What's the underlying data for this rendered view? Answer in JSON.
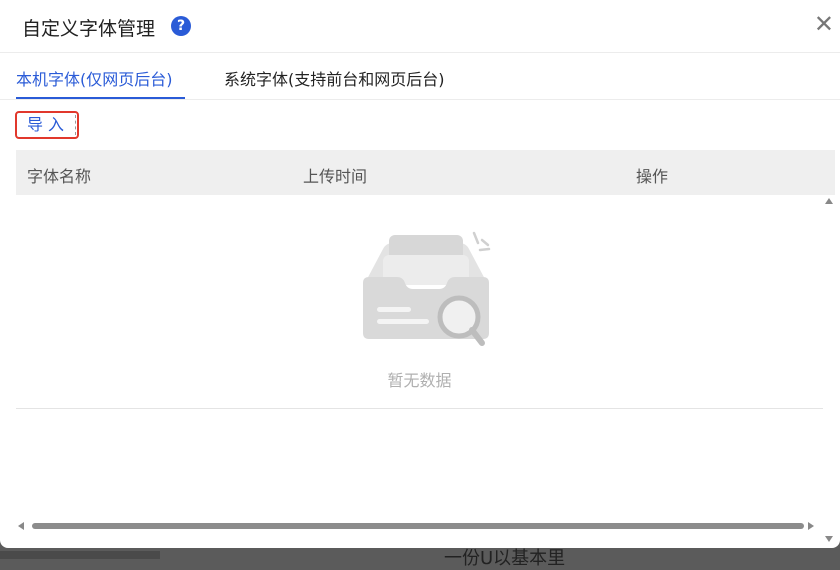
{
  "background_page": {
    "partial_text": "一份U以基本里"
  },
  "dialog": {
    "title": "自定义字体管理",
    "help_glyph": "?",
    "close_glyph": "✕",
    "tabs": [
      {
        "label": "本机字体(仅网页后台)",
        "active": true
      },
      {
        "label": "系统字体(支持前台和网页后台)",
        "active": false
      }
    ],
    "import_label": "导入",
    "table": {
      "columns": [
        "字体名称",
        "上传时间",
        "操作"
      ],
      "rows": []
    },
    "empty_text": "暂无数据"
  },
  "icons": {
    "help": "question-circle-icon",
    "close": "close-icon",
    "empty": "empty-inbox-search-icon"
  },
  "colors": {
    "accent": "#2a5bd7",
    "highlight_border": "#e1382c",
    "table_header_bg": "#efefef",
    "muted_text": "#b0b0b0"
  }
}
